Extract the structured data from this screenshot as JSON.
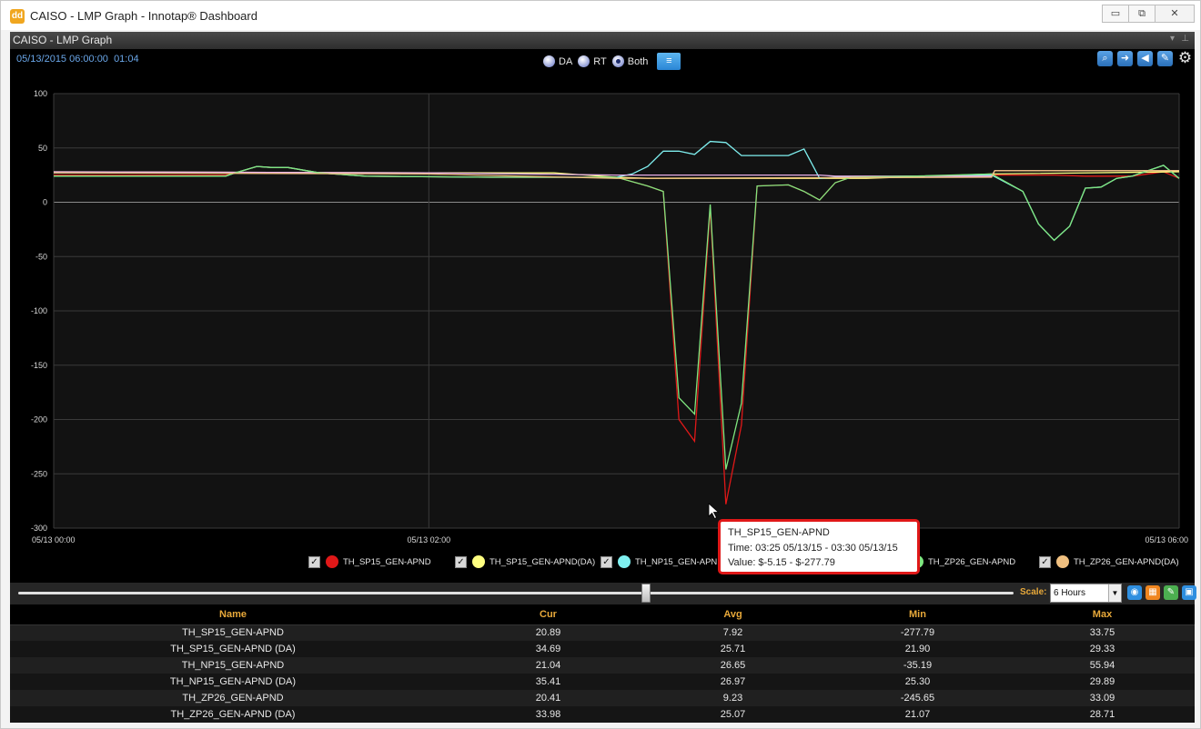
{
  "window": {
    "title": "CAISO - LMP Graph - Innotap® Dashboard",
    "app_icon": "dd",
    "controls": {
      "minimize": "▭",
      "maximize": "⧉",
      "close": "✕"
    }
  },
  "panel": {
    "title": "CAISO - LMP Graph",
    "pin_glyph": "⊥",
    "menu_glyph": "▾"
  },
  "toolbar": {
    "datetime": "05/13/2015 06:00:00",
    "elapsed": "01:04",
    "radio_options": [
      {
        "label": "DA",
        "selected": false
      },
      {
        "label": "RT",
        "selected": false
      },
      {
        "label": "Both",
        "selected": true
      }
    ],
    "list_icon": "≡",
    "tools": [
      "zoom-icon",
      "forward-icon",
      "speaker-icon",
      "edit-icon",
      "gear-icon"
    ]
  },
  "chart_data": {
    "type": "line",
    "x_unit": "minutes from 05/13 00:00",
    "xlim": [
      0,
      360
    ],
    "ylim": [
      -300,
      100
    ],
    "y_ticks": [
      100,
      50,
      0,
      -50,
      -100,
      -150,
      -200,
      -250,
      -300
    ],
    "x_ticks": [
      {
        "x": 0,
        "label": "05/13 00:00"
      },
      {
        "x": 120,
        "label": "05/13 02:00"
      },
      {
        "x": 360,
        "label": "05/13 06:00"
      }
    ],
    "grid": true,
    "series": [
      {
        "name": "TH_SP15_GEN-APND",
        "color": "#e01818",
        "points": [
          [
            0,
            25
          ],
          [
            55,
            25
          ],
          [
            58,
            27
          ],
          [
            65,
            33
          ],
          [
            70,
            32
          ],
          [
            75,
            32
          ],
          [
            85,
            27
          ],
          [
            100,
            24
          ],
          [
            140,
            23
          ],
          [
            180,
            23
          ],
          [
            190,
            15
          ],
          [
            195,
            10
          ],
          [
            200,
            -200
          ],
          [
            205,
            -220
          ],
          [
            210,
            -5
          ],
          [
            215,
            -278
          ],
          [
            220,
            -205
          ],
          [
            225,
            15
          ],
          [
            235,
            16
          ],
          [
            240,
            10
          ],
          [
            245,
            2
          ],
          [
            250,
            18
          ],
          [
            255,
            23
          ],
          [
            275,
            24
          ],
          [
            300,
            25
          ],
          [
            310,
            25
          ],
          [
            320,
            25
          ],
          [
            330,
            24
          ],
          [
            345,
            24
          ],
          [
            355,
            28
          ],
          [
            360,
            22
          ]
        ]
      },
      {
        "name": "TH_SP15_GEN-APND(DA)",
        "color": "#ffff80",
        "points": [
          [
            0,
            28
          ],
          [
            120,
            27
          ],
          [
            160,
            27
          ],
          [
            180,
            23
          ],
          [
            190,
            22
          ],
          [
            260,
            22
          ],
          [
            300,
            26
          ],
          [
            360,
            28
          ]
        ]
      },
      {
        "name": "TH_NP15_GEN-APND",
        "color": "#7ff0f0",
        "points": [
          [
            0,
            24
          ],
          [
            55,
            24
          ],
          [
            58,
            27
          ],
          [
            65,
            33
          ],
          [
            70,
            32
          ],
          [
            75,
            32
          ],
          [
            85,
            27
          ],
          [
            100,
            24
          ],
          [
            140,
            23
          ],
          [
            180,
            23
          ],
          [
            185,
            26
          ],
          [
            190,
            33
          ],
          [
            195,
            47
          ],
          [
            200,
            47
          ],
          [
            205,
            44
          ],
          [
            210,
            56
          ],
          [
            215,
            55
          ],
          [
            220,
            43
          ],
          [
            230,
            43
          ],
          [
            235,
            43
          ],
          [
            240,
            49
          ],
          [
            245,
            22
          ],
          [
            250,
            23
          ],
          [
            275,
            24
          ],
          [
            300,
            25
          ],
          [
            310,
            10
          ],
          [
            315,
            -20
          ],
          [
            320,
            -35
          ],
          [
            325,
            -22
          ],
          [
            330,
            13
          ],
          [
            335,
            14
          ],
          [
            340,
            22
          ],
          [
            345,
            24
          ],
          [
            355,
            34
          ],
          [
            360,
            22
          ]
        ]
      },
      {
        "name": "TH_NP15_GEN-APND (DA)",
        "color": "#e8b0e8",
        "points": [
          [
            0,
            28
          ],
          [
            120,
            27
          ],
          [
            180,
            25
          ],
          [
            245,
            25
          ],
          [
            250,
            24
          ],
          [
            300,
            24
          ],
          [
            301,
            29
          ],
          [
            360,
            29
          ]
        ]
      },
      {
        "name": "TH_ZP26_GEN-APND",
        "color": "#7fe67f",
        "points": [
          [
            0,
            24
          ],
          [
            55,
            24
          ],
          [
            58,
            27
          ],
          [
            65,
            33
          ],
          [
            70,
            32
          ],
          [
            75,
            32
          ],
          [
            85,
            27
          ],
          [
            100,
            24
          ],
          [
            140,
            23
          ],
          [
            180,
            23
          ],
          [
            190,
            15
          ],
          [
            195,
            10
          ],
          [
            200,
            -180
          ],
          [
            205,
            -195
          ],
          [
            210,
            -2
          ],
          [
            215,
            -246
          ],
          [
            220,
            -185
          ],
          [
            225,
            15
          ],
          [
            235,
            16
          ],
          [
            240,
            10
          ],
          [
            245,
            2
          ],
          [
            250,
            18
          ],
          [
            255,
            23
          ],
          [
            275,
            24
          ],
          [
            300,
            26
          ],
          [
            310,
            10
          ],
          [
            315,
            -20
          ],
          [
            320,
            -35
          ],
          [
            325,
            -22
          ],
          [
            330,
            13
          ],
          [
            335,
            14
          ],
          [
            340,
            22
          ],
          [
            345,
            24
          ],
          [
            355,
            34
          ],
          [
            360,
            22
          ]
        ]
      },
      {
        "name": "TH_ZP26_GEN-APND(DA)",
        "color": "#f0c080",
        "points": [
          [
            0,
            27
          ],
          [
            120,
            26
          ],
          [
            180,
            22
          ],
          [
            300,
            23
          ],
          [
            301,
            29
          ],
          [
            360,
            29
          ]
        ]
      }
    ]
  },
  "legend": {
    "check_glyph": "✓",
    "items": [
      {
        "label": "TH_SP15_GEN-APND",
        "color": "#e01818"
      },
      {
        "label": "TH_SP15_GEN-APND(DA)",
        "color": "#ffff80"
      },
      {
        "label": "TH_NP15_GEN-APND",
        "color": "#7ff0f0"
      },
      {
        "label": "TH_ZP26_GEN-APND",
        "color": "#7fe67f"
      },
      {
        "label": "TH_ZP26_GEN-APND(DA)",
        "color": "#f0c080"
      }
    ]
  },
  "tooltip": {
    "title": "TH_SP15_GEN-APND",
    "time": "Time: 03:25 05/13/15 - 03:30 05/13/15",
    "value": "Value: $-5.15 - $-277.79"
  },
  "scale": {
    "label": "Scale:",
    "value": "6 Hours",
    "arrow": "▼"
  },
  "bar_tools": [
    {
      "name": "eye-icon",
      "glyph": "◉",
      "color": "#2f8fe0"
    },
    {
      "name": "grid-icon",
      "glyph": "▦",
      "color": "#f0861f"
    },
    {
      "name": "pen-icon",
      "glyph": "✎",
      "color": "#4caf50"
    },
    {
      "name": "save-icon",
      "glyph": "▣",
      "color": "#2f8fe0"
    }
  ],
  "stats": {
    "columns": [
      "Name",
      "Cur",
      "Avg",
      "Min",
      "Max"
    ],
    "rows": [
      [
        "TH_SP15_GEN-APND",
        "20.89",
        "7.92",
        "-277.79",
        "33.75"
      ],
      [
        "TH_SP15_GEN-APND (DA)",
        "34.69",
        "25.71",
        "21.90",
        "29.33"
      ],
      [
        "TH_NP15_GEN-APND",
        "21.04",
        "26.65",
        "-35.19",
        "55.94"
      ],
      [
        "TH_NP15_GEN-APND (DA)",
        "35.41",
        "26.97",
        "25.30",
        "29.89"
      ],
      [
        "TH_ZP26_GEN-APND",
        "20.41",
        "9.23",
        "-245.65",
        "33.09"
      ],
      [
        "TH_ZP26_GEN-APND (DA)",
        "33.98",
        "25.07",
        "21.07",
        "28.71"
      ]
    ]
  }
}
